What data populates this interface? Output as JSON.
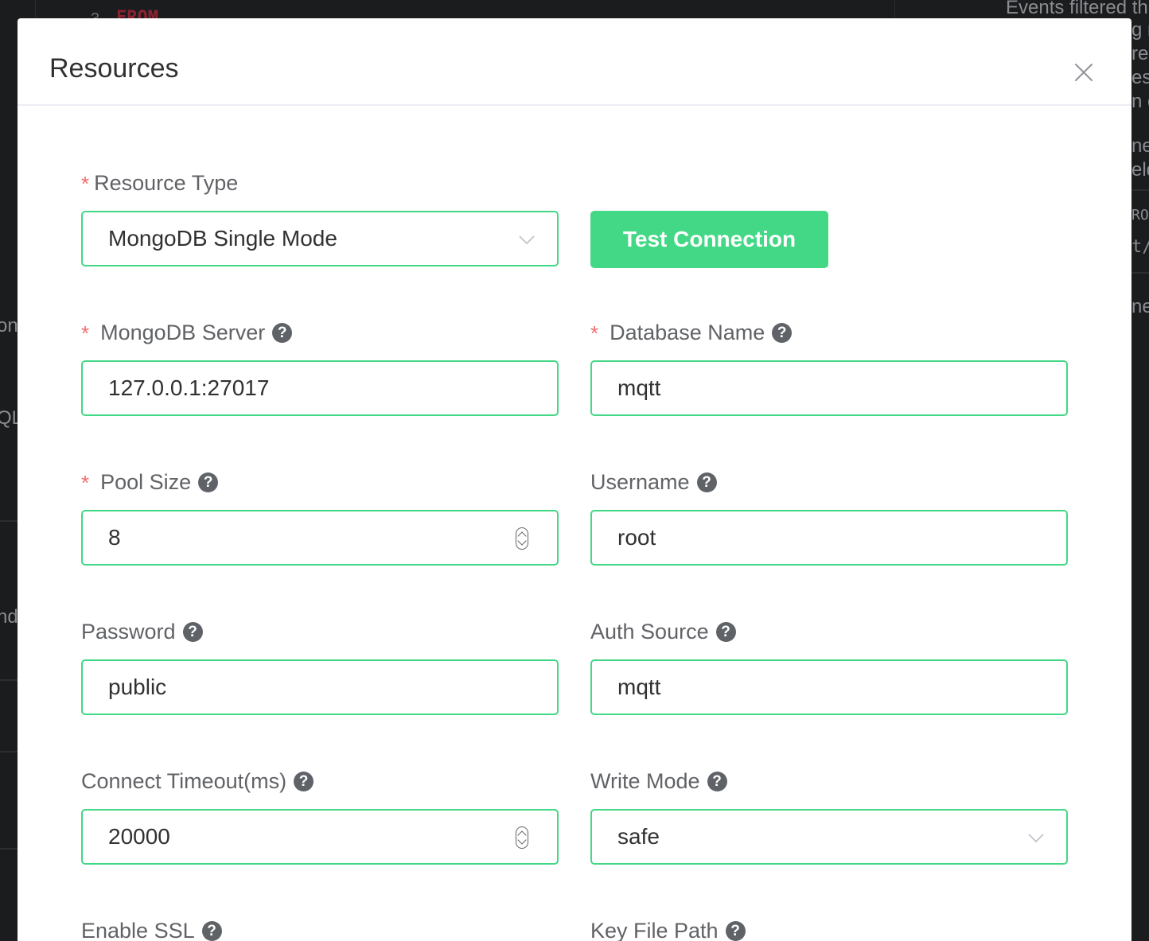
{
  "background": {
    "top_fragment": "FROM",
    "top_number": "3",
    "right_fragments": [
      "Events filtered th",
      "g r",
      "re",
      "es",
      "n c",
      "ne",
      "eld",
      "RO",
      "t/",
      "ne"
    ],
    "left_fragments": [
      "on",
      "QL",
      "nd"
    ]
  },
  "modal": {
    "title": "Resources",
    "test_button": "Test Connection",
    "fields": {
      "resource_type": {
        "label": "Resource Type",
        "required": "*",
        "value": "MongoDB Single Mode"
      },
      "mongodb_server": {
        "label": "MongoDB Server",
        "required": "*",
        "value": "127.0.0.1:27017"
      },
      "database_name": {
        "label": "Database Name",
        "required": "*",
        "value": "mqtt"
      },
      "pool_size": {
        "label": "Pool Size",
        "required": "*",
        "value": "8"
      },
      "username": {
        "label": "Username",
        "value": "root"
      },
      "password": {
        "label": "Password",
        "value": "public"
      },
      "auth_source": {
        "label": "Auth Source",
        "value": "mqtt"
      },
      "connect_timeout": {
        "label": "Connect Timeout(ms)",
        "value": "20000"
      },
      "write_mode": {
        "label": "Write Mode",
        "value": "safe"
      },
      "enable_ssl": {
        "label": "Enable SSL"
      },
      "key_file_path": {
        "label": "Key File Path"
      }
    },
    "help_glyph": "?"
  },
  "colors": {
    "accent": "#42d885",
    "required": "#f56c6c",
    "label": "#606266",
    "text": "#303133"
  }
}
